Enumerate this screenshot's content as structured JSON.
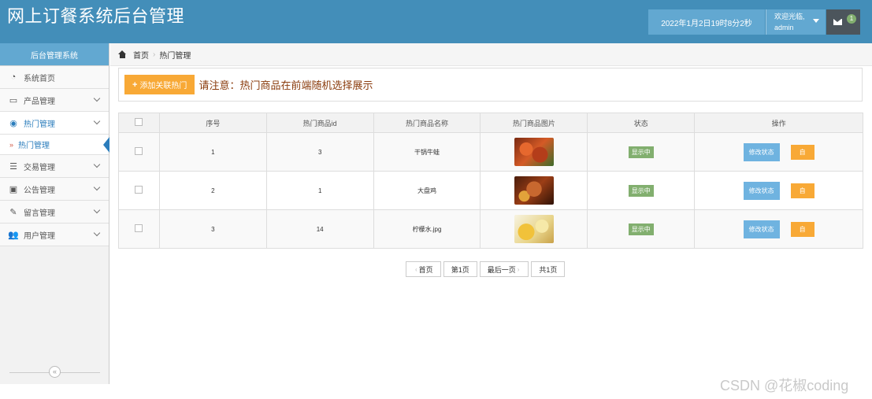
{
  "header": {
    "title": "网上订餐系统后台管理",
    "datetime": "2022年1月2日19时8分2秒",
    "welcome": "欢迎光临,",
    "username": "admin",
    "mail_count": "1"
  },
  "sidebar": {
    "title": "后台管理系统",
    "items": [
      {
        "label": "系统首页",
        "icon": "tachometer-icon"
      },
      {
        "label": "产品管理",
        "icon": "desktop-icon"
      },
      {
        "label": "热门管理",
        "icon": "eye-icon"
      },
      {
        "label": "交易管理",
        "icon": "list-icon"
      },
      {
        "label": "公告管理",
        "icon": "picture-icon"
      },
      {
        "label": "留言管理",
        "icon": "edit-icon"
      },
      {
        "label": "用户管理",
        "icon": "users-icon"
      }
    ],
    "subitem": "热门管理",
    "collapse": "«"
  },
  "breadcrumb": {
    "home": "首页",
    "current": "热门管理"
  },
  "toolbar": {
    "add_label": "添加关联热门",
    "notice": "请注意：热门商品在前端随机选择展示"
  },
  "table": {
    "headers": [
      "序号",
      "热门商品id",
      "热门商品名称",
      "热门商品图片",
      "状态",
      "操作"
    ],
    "rows": [
      {
        "no": "1",
        "id": "3",
        "name": "干锅牛蛙",
        "status": "显示中",
        "edit": "修改状态",
        "del": "自"
      },
      {
        "no": "2",
        "id": "1",
        "name": "大盘鸡",
        "status": "显示中",
        "edit": "修改状态",
        "del": "自"
      },
      {
        "no": "3",
        "id": "14",
        "name": "柠檬水.jpg",
        "status": "显示中",
        "edit": "修改状态",
        "del": "自"
      }
    ]
  },
  "pagination": {
    "first": "首页",
    "current": "第1页",
    "last": "最后一页",
    "total": "共1页"
  },
  "watermark": "CSDN @花椒coding",
  "colors": {
    "brand": "#438eb9",
    "accent_orange": "#f8a936",
    "status_green": "#82af6f",
    "button_blue": "#6fb3e0"
  }
}
